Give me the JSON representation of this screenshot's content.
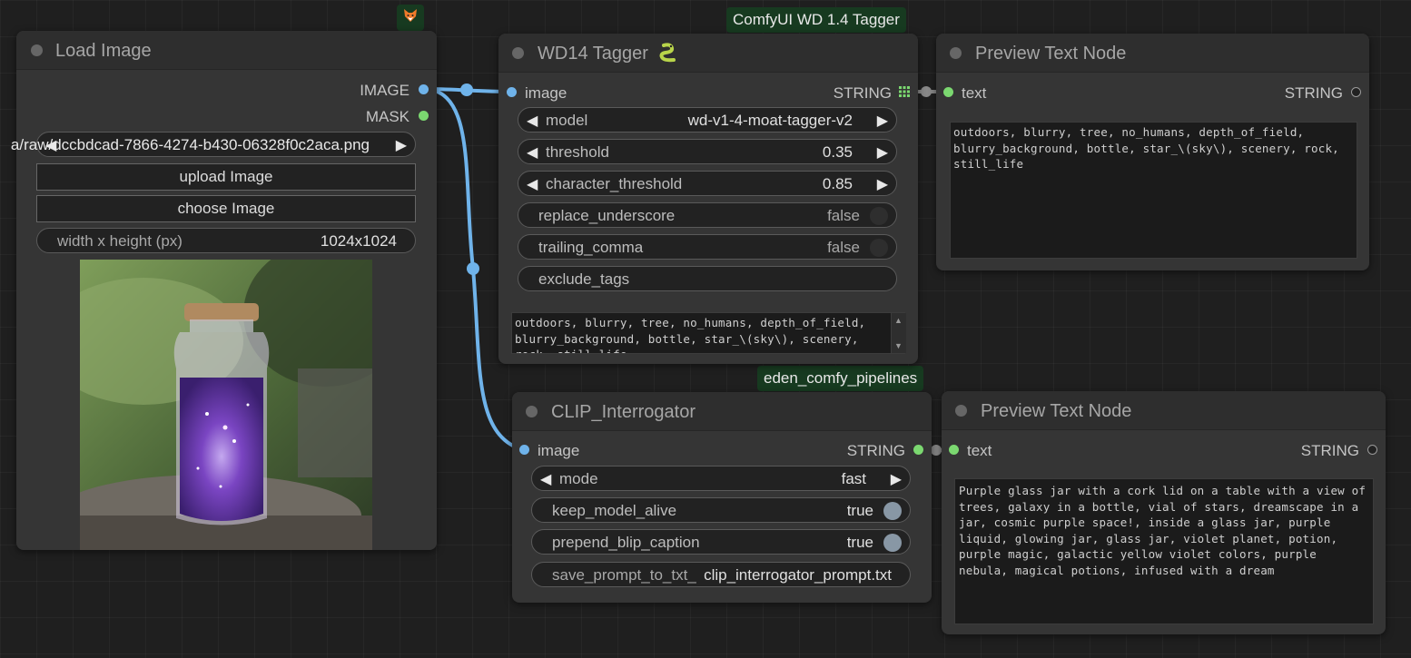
{
  "colors": {
    "image_wire": "#6fb3ea",
    "string_slot": "#7bd870",
    "badge_bg": "#173a20"
  },
  "badges": {
    "fox_icon": "fox-icon",
    "wd_tagger": "ComfyUI WD 1.4 Tagger",
    "eden": "eden_comfy_pipelines"
  },
  "load_image": {
    "title": "Load Image",
    "outputs": {
      "image": "IMAGE",
      "mask": "MASK"
    },
    "image_filename": "a/raw/dccbdcad-7866-4274-b430-06328f0c2aca.png",
    "upload_label": "upload Image",
    "choose_label": "choose Image",
    "size_label": "width x height (px)",
    "size_value": "1024x1024",
    "preview_alt": "purple galaxy in a glass jar"
  },
  "wd14": {
    "title": "WD14 Tagger",
    "title_icon": "snake-icon",
    "input": "image",
    "output": "STRING",
    "model_label": "model",
    "model_value": "wd-v1-4-moat-tagger-v2",
    "threshold_label": "threshold",
    "threshold_value": "0.35",
    "char_threshold_label": "character_threshold",
    "char_threshold_value": "0.85",
    "replace_label": "replace_underscore",
    "replace_value": "false",
    "trailing_label": "trailing_comma",
    "trailing_value": "false",
    "exclude_label": "exclude_tags",
    "tags_text": "outdoors, blurry, tree, no_humans, depth_of_field, blurry_background, bottle, star_\\(sky\\), scenery, rock, still_life"
  },
  "preview1": {
    "title": "Preview Text Node",
    "input": "text",
    "output": "STRING",
    "text": "outdoors, blurry, tree, no_humans, depth_of_field, blurry_background, bottle, star_\\(sky\\), scenery, rock, still_life"
  },
  "clip": {
    "title": "CLIP_Interrogator",
    "input": "image",
    "output": "STRING",
    "mode_label": "mode",
    "mode_value": "fast",
    "keep_label": "keep_model_alive",
    "keep_value": "true",
    "prepend_label": "prepend_blip_caption",
    "prepend_value": "true",
    "save_label": "save_prompt_to_txt_",
    "save_value": "clip_interrogator_prompt.txt"
  },
  "preview2": {
    "title": "Preview Text Node",
    "input": "text",
    "output": "STRING",
    "text": "Purple glass jar with a cork lid on a table with a view of trees, galaxy in a bottle, vial of stars, dreamscape in a jar, cosmic purple space!, inside a glass jar, purple liquid, glowing jar, glass jar, violet planet, potion, purple magic, galactic yellow violet colors, purple nebula, magical potions, infused with a dream"
  }
}
